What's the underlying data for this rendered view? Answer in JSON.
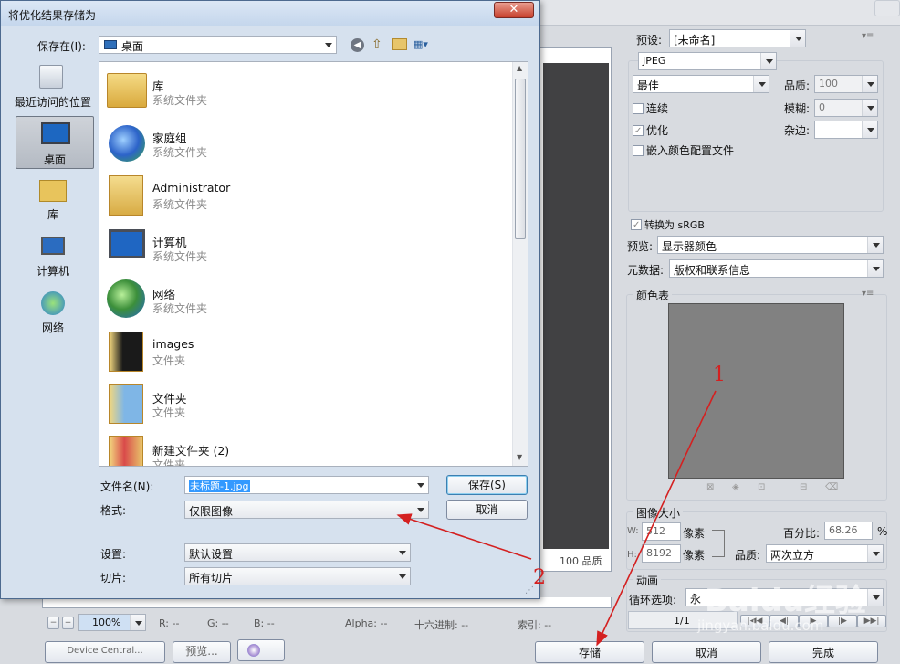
{
  "dialog": {
    "title": "将优化结果存储为",
    "save_in_label": "保存在(I):",
    "save_in_value": "桌面",
    "places": [
      "最近访问的位置",
      "桌面",
      "库",
      "计算机",
      "网络"
    ],
    "files": [
      {
        "name": "库",
        "type": "系统文件夹"
      },
      {
        "name": "家庭组",
        "type": "系统文件夹"
      },
      {
        "name": "Administrator",
        "type": "系统文件夹"
      },
      {
        "name": "计算机",
        "type": "系统文件夹"
      },
      {
        "name": "网络",
        "type": "系统文件夹"
      },
      {
        "name": "images",
        "type": "文件夹"
      },
      {
        "name": "文件夹",
        "type": "文件夹"
      },
      {
        "name": "新建文件夹 (2)",
        "type": "文件夹"
      }
    ],
    "filename_label": "文件名(N):",
    "filename_value": "未标题-1.jpg",
    "format_label": "格式:",
    "format_value": "仅限图像",
    "save_button": "保存(S)",
    "cancel_button": "取消",
    "settings_label": "设置:",
    "settings_value": "默认设置",
    "slices_label": "切片:",
    "slices_value": "所有切片"
  },
  "right_panel": {
    "preset_label": "预设:",
    "preset_value": "[未命名]",
    "format": "JPEG",
    "quality_preset": "最佳",
    "quality_label": "品质:",
    "quality_value": "100",
    "progressive": "连续",
    "blur_label": "模糊:",
    "blur_value": "0",
    "optimized": "优化",
    "matte_label": "杂边:",
    "embed_profile": "嵌入颜色配置文件",
    "convert_srgb": "转换为 sRGB",
    "preview_label": "预览:",
    "preview_value": "显示器颜色",
    "metadata_label": "元数据:",
    "metadata_value": "版权和联系信息",
    "color_table_title": "颜色表",
    "image_size_title": "图像大小",
    "w_label": "W:",
    "w_value": "512",
    "h_label": "H:",
    "h_value": "8192",
    "pixels": "像素",
    "percent_label": "百分比:",
    "percent_value": "68.26",
    "percent_unit": "%",
    "resample_label": "品质:",
    "resample_value": "两次立方",
    "animation_title": "动画",
    "loop_label": "循环选项:",
    "loop_value": "永",
    "frame_counter": "1/1"
  },
  "status": {
    "zoom": "100%",
    "r": "R: --",
    "g": "G: --",
    "b": "B: --",
    "alpha": "Alpha: --",
    "hex": "十六进制: --",
    "index": "索引: --",
    "canvas_quality": "100 品质"
  },
  "bottom": {
    "device_central": "Device Central...",
    "preview": "预览...",
    "store": "存储",
    "cancel": "取消",
    "done": "完成"
  },
  "annotations": {
    "label1": "1",
    "label2": "2",
    "color": "#d42020"
  },
  "watermark": {
    "site": "Baidu经验",
    "url": "jingyan.baidu.com"
  }
}
